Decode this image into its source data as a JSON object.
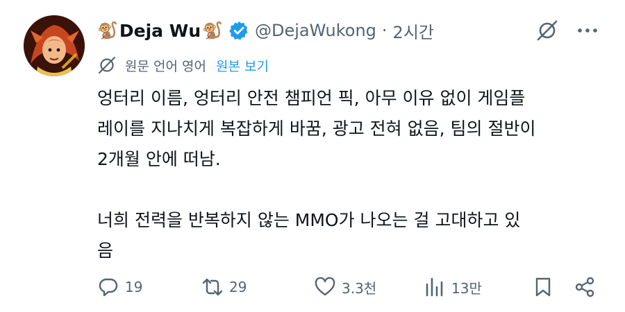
{
  "author": {
    "display_name": "Deja Wu",
    "name_emoji_left": "🐒",
    "name_emoji_right": "🐒",
    "handle": "@DejaWukong",
    "separator": "·",
    "time_ago": "2시간"
  },
  "translation": {
    "meta": "원문 언어 영어",
    "link": "원본 보기"
  },
  "tweet": {
    "lines": [
      "엉터리 이름, 엉터리 안전 챔피언 픽, 아무 이유 없이 게임플",
      "레이를 지나치게 복잡하게 바꿈, 광고 전혀 없음, 팀의 절반이",
      "2개월 안에 떠남.",
      "너희 전력을 반복하지 않는 MMO가 나오는 걸 고대하고 있",
      "음"
    ]
  },
  "metrics": {
    "replies": "19",
    "retweets": "29",
    "likes": "3.3천",
    "views": "13만"
  },
  "colors": {
    "text": "#0f1419",
    "muted": "#536471",
    "link": "#1d9bf0",
    "verified": "#1d9bf0"
  },
  "icons": [
    "verified-badge-icon",
    "grok-icon",
    "more-icon",
    "translate-icon",
    "reply-icon",
    "retweet-icon",
    "like-icon",
    "views-icon",
    "bookmark-icon",
    "share-icon"
  ]
}
